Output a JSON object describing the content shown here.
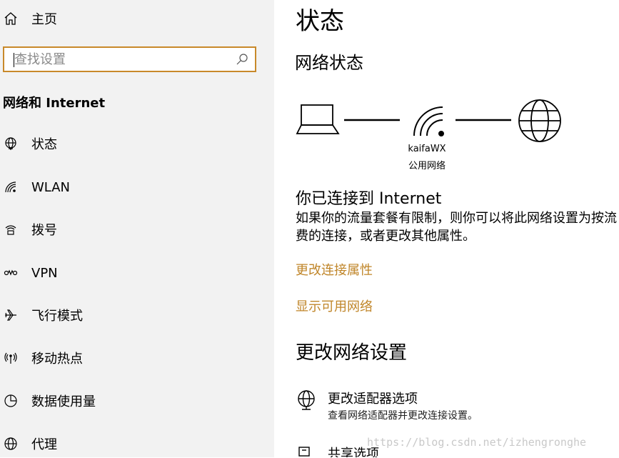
{
  "sidebar": {
    "home_label": "主页",
    "search": {
      "placeholder": "查找设置"
    },
    "section_title": "网络和 Internet",
    "items": [
      {
        "label": "状态",
        "icon": "globe-status-icon"
      },
      {
        "label": "WLAN",
        "icon": "wifi-icon"
      },
      {
        "label": "拨号",
        "icon": "dialup-icon"
      },
      {
        "label": "VPN",
        "icon": "vpn-icon"
      },
      {
        "label": "飞行模式",
        "icon": "airplane-icon"
      },
      {
        "label": "移动热点",
        "icon": "hotspot-icon"
      },
      {
        "label": "数据使用量",
        "icon": "data-usage-icon"
      },
      {
        "label": "代理",
        "icon": "proxy-globe-icon"
      }
    ]
  },
  "main": {
    "title": "状态",
    "network_status_title": "网络状态",
    "network": {
      "name": "kaifaWX",
      "type": "公用网络"
    },
    "connected_text": "你已连接到 Internet",
    "description_line1": "如果你的流量套餐有限制，则你可以将此网络设置为按流",
    "description_line2": "费的连接，或者更改其他属性。",
    "link_change_properties": "更改连接属性",
    "link_show_networks": "显示可用网络",
    "change_settings_title": "更改网络设置",
    "options": [
      {
        "title": "更改适配器选项",
        "desc": "查看网络适配器并更改连接设置。",
        "icon": "adapter-globe-icon"
      },
      {
        "title": "共享选项",
        "icon": "sharing-icon"
      }
    ]
  },
  "watermark": "https://blog.csdn.net/izhengronghe",
  "colors": {
    "accent": "#c8892a",
    "link": "#c0862a",
    "sidebar_bg": "#f2f2f2"
  }
}
